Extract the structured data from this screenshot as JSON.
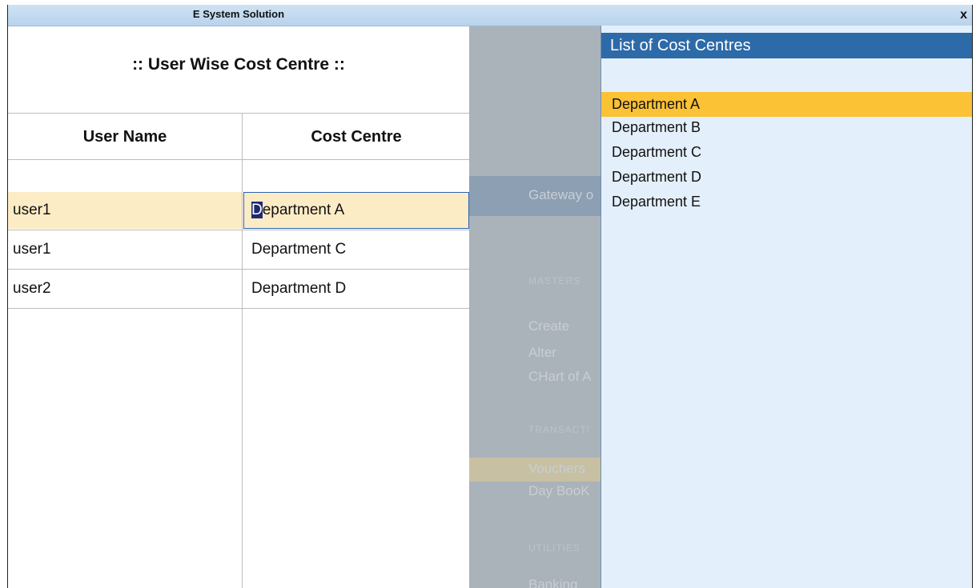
{
  "window": {
    "title": "E System Solution",
    "close_label": "x"
  },
  "form": {
    "title": ":: User Wise Cost Centre ::",
    "columns": {
      "user": "User Name",
      "cost_centre": "Cost Centre"
    },
    "rows": [
      {
        "user": "user1",
        "cost_centre_first": "D",
        "cost_centre_rest": "epartment A"
      },
      {
        "user": "user1",
        "cost_centre": "Department C"
      },
      {
        "user": "user2",
        "cost_centre": "Department D"
      }
    ]
  },
  "background_screen": {
    "header": "Gateway o",
    "section_masters": "MASTERS",
    "items_masters": [
      "Create",
      "Alter",
      "CHart of A"
    ],
    "section_transactions": "TRANSACTI",
    "items_transactions": [
      "Vouchers",
      "Day BooK"
    ],
    "section_utilities": "UTILITIES",
    "items_utilities": [
      "Banking"
    ]
  },
  "cost_centre_list": {
    "title": "List of Cost Centres",
    "items": [
      "Department A",
      "Department B",
      "Department C",
      "Department D",
      "Department E"
    ],
    "selected_index": 0
  },
  "colors": {
    "list_header": "#2d6aa8",
    "list_selected": "#fbc235",
    "active_row": "#fcecc6",
    "list_background": "#e3effa"
  }
}
